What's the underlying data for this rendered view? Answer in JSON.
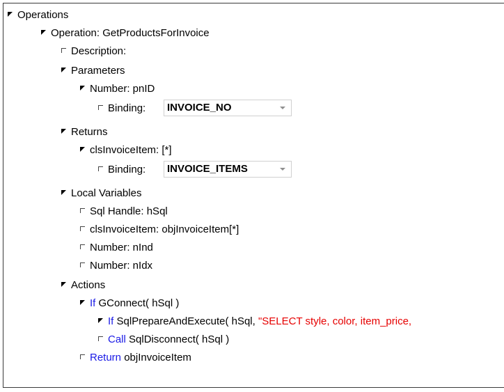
{
  "tree": {
    "operations": "Operations",
    "operation": "Operation: GetProductsForInvoice",
    "description": "Description:",
    "parameters": "Parameters",
    "param_number": "Number: pnID",
    "binding_label": "Binding:",
    "param_binding_value": "INVOICE_NO",
    "returns": "Returns",
    "returns_item": "clsInvoiceItem: [*]",
    "returns_binding_value": "INVOICE_ITEMS",
    "local_variables": "Local Variables",
    "lv_sql": "Sql Handle: hSql",
    "lv_item": "clsInvoiceItem: objInvoiceItem[*]",
    "lv_nind": "Number: nInd",
    "lv_nidx": "Number: nIdx",
    "actions": "Actions",
    "if_kw": "If",
    "if1_expr": "GConnect( hSql )",
    "if2_expr": "SqlPrepareAndExecute( hSql, ",
    "if2_string": "\"SELECT style, color, item_price,",
    "call_kw": "Call",
    "call_expr": "SqlDisconnect( hSql )",
    "return_kw": "Return",
    "return_expr": "objInvoiceItem"
  }
}
